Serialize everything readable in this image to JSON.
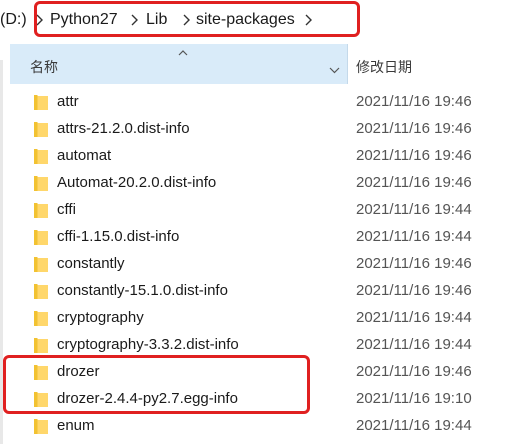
{
  "breadcrumb": {
    "drive_fragment": "(D:)",
    "items": [
      "Python27",
      "Lib",
      "site-packages"
    ]
  },
  "columns": {
    "name": "名称",
    "modified": "修改日期"
  },
  "files": [
    {
      "name": "attr",
      "modified": "2021/11/16 19:46"
    },
    {
      "name": "attrs-21.2.0.dist-info",
      "modified": "2021/11/16 19:46"
    },
    {
      "name": "automat",
      "modified": "2021/11/16 19:46"
    },
    {
      "name": "Automat-20.2.0.dist-info",
      "modified": "2021/11/16 19:46"
    },
    {
      "name": "cffi",
      "modified": "2021/11/16 19:44"
    },
    {
      "name": "cffi-1.15.0.dist-info",
      "modified": "2021/11/16 19:44"
    },
    {
      "name": "constantly",
      "modified": "2021/11/16 19:46"
    },
    {
      "name": "constantly-15.1.0.dist-info",
      "modified": "2021/11/16 19:46"
    },
    {
      "name": "cryptography",
      "modified": "2021/11/16 19:44"
    },
    {
      "name": "cryptography-3.3.2.dist-info",
      "modified": "2021/11/16 19:44"
    },
    {
      "name": "drozer",
      "modified": "2021/11/16 19:46"
    },
    {
      "name": "drozer-2.4.4-py2.7.egg-info",
      "modified": "2021/11/16 19:10"
    },
    {
      "name": "enum",
      "modified": "2021/11/16 19:44"
    }
  ],
  "colors": {
    "highlight": "#e02020",
    "header_bg": "#d9ebf9",
    "folder": "#f5c542"
  },
  "icons": {
    "folder": "folder-icon",
    "separator": "chevron-right-icon",
    "sort": "sort-up-icon",
    "dropdown": "chevron-down-icon"
  }
}
